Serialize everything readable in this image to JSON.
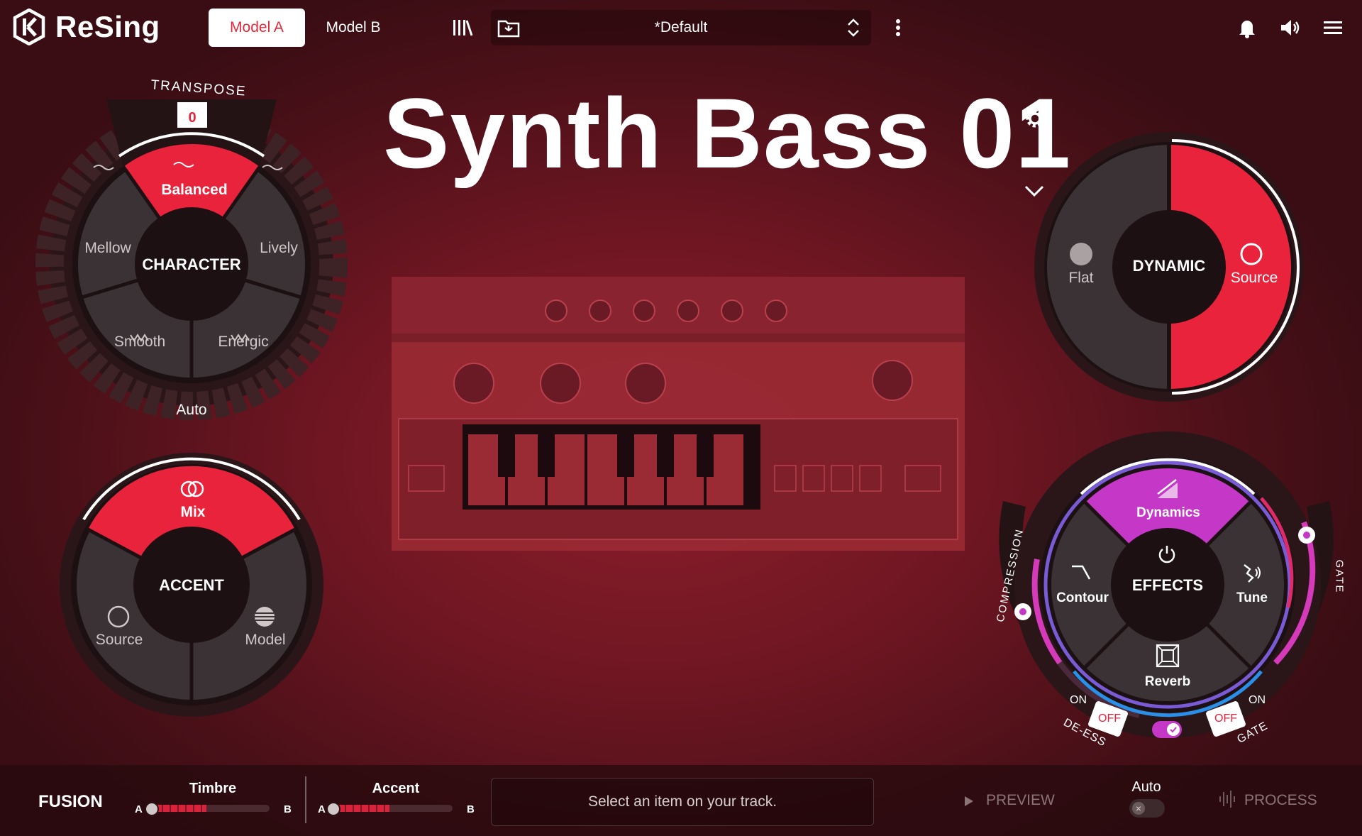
{
  "app": {
    "name": "ReSing"
  },
  "header": {
    "tabs": [
      {
        "label": "Model A",
        "active": true
      },
      {
        "label": "Model B",
        "active": false
      }
    ],
    "preset": "*Default"
  },
  "title": "Synth Bass 01",
  "character": {
    "transpose_label": "TRANSPOSE",
    "transpose_value": "0",
    "center": "CHARACTER",
    "options": {
      "top": "Balanced",
      "left": "Mellow",
      "right": "Lively",
      "bottom_left": "Smooth",
      "bottom_right": "Energic"
    },
    "selected": "Balanced",
    "auto_label": "Auto"
  },
  "accent": {
    "center": "ACCENT",
    "options": {
      "top": "Mix",
      "left": "Source",
      "right": "Model"
    },
    "selected": "Mix"
  },
  "dynamic": {
    "center": "DYNAMIC",
    "options": {
      "left": "Flat",
      "right": "Source"
    },
    "selected": "Source"
  },
  "effects": {
    "center": "EFFECTS",
    "options": {
      "top": "Dynamics",
      "left": "Contour",
      "right": "Tune",
      "bottom": "Reverb"
    },
    "selected": "Dynamics",
    "compression_label": "COMPRESSION",
    "gate_label": "GATE",
    "deess": {
      "label": "DE-ESS",
      "on": "ON",
      "off": "OFF"
    },
    "gate_toggle": {
      "label": "GATE",
      "on": "ON",
      "off": "OFF"
    }
  },
  "footer": {
    "fusion": "FUSION",
    "timbre": {
      "label": "Timbre",
      "a": "A",
      "b": "B",
      "value": 0.48
    },
    "accent": {
      "label": "Accent",
      "a": "A",
      "b": "B",
      "value": 0.48
    },
    "status": "Select an item on your track.",
    "preview": "PREVIEW",
    "auto": "Auto",
    "process": "PROCESS"
  },
  "colors": {
    "accent": "#e8233b",
    "effects": "#c437c7",
    "dial_dark": "#1c1012",
    "segment": "#3a3234"
  }
}
